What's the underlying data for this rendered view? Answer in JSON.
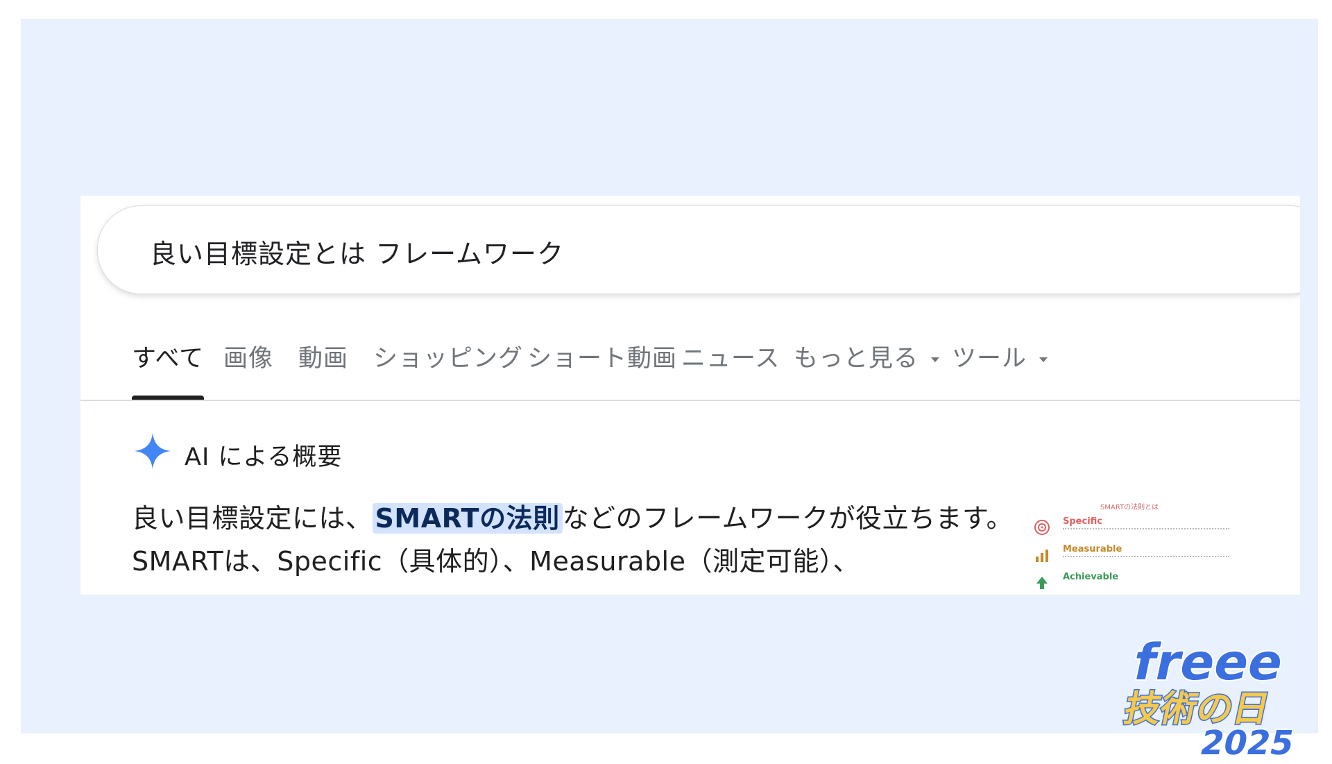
{
  "search": {
    "query": "良い目標設定とは フレームワーク"
  },
  "tabs": [
    {
      "label": "すべて",
      "active": true
    },
    {
      "label": "画像"
    },
    {
      "label": "動画"
    },
    {
      "label": "ショッピング"
    },
    {
      "label": "ショート動画"
    },
    {
      "label": "ニュース"
    },
    {
      "label": "もっと見る",
      "dropdown": true
    },
    {
      "label": "ツール",
      "dropdown": true
    }
  ],
  "ai_overview": {
    "icon": "gemini-sparkle-icon",
    "title": "AI による概要",
    "body_before": "良い目標設定には、",
    "highlight": "SMARTの法則",
    "body_after": "などのフレームワークが役立ちます。SMARTは、Specific（具体的）、Measurable（測定可能）、"
  },
  "thumbnail": {
    "title": "SMARTの法則とは",
    "rows": [
      {
        "word": "Specific",
        "color": "#e06060"
      },
      {
        "word": "Measurable",
        "color": "#c58a2a"
      },
      {
        "word": "Achievable",
        "color": "#3c9a5a"
      }
    ]
  },
  "logo": {
    "brand": "freee",
    "line2": "技術の日",
    "year": "2025",
    "colors": {
      "blue": "#3b6fe0",
      "yellow": "#f6c94a"
    }
  },
  "colors": {
    "background": "#e8f1fd",
    "highlight": "#d3e3fd",
    "ai_icon": "#4285f4"
  }
}
